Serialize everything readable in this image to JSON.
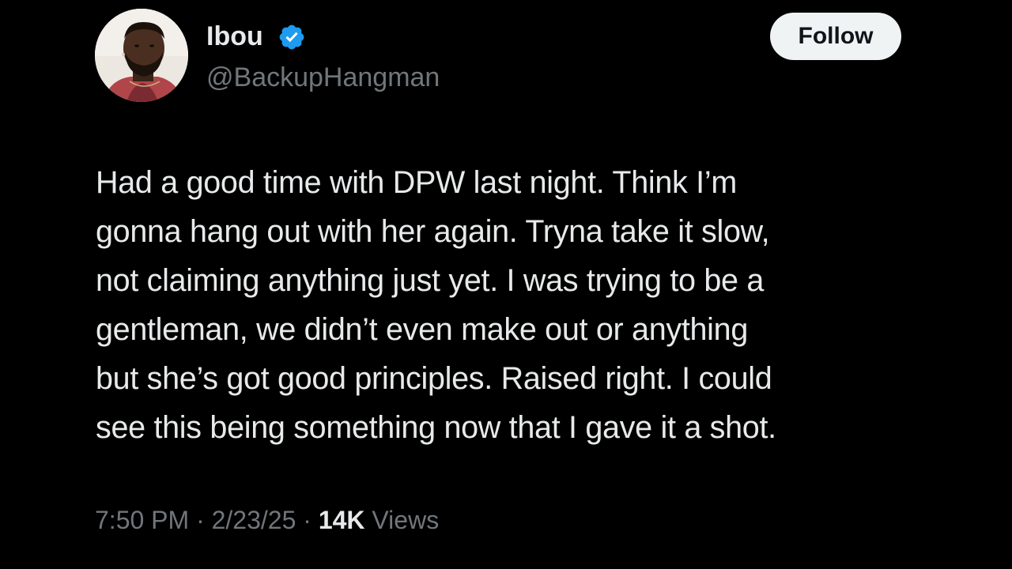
{
  "author": {
    "display_name": "Ibou",
    "handle": "@BackupHangman",
    "verified_icon": "verified-badge-icon",
    "avatar_icon": "profile-avatar"
  },
  "follow_button": {
    "label": "Follow"
  },
  "tweet": {
    "lines": [
      "Had a good time with DPW last night. Think I’m",
      "gonna hang out with her again. Tryna take it slow,",
      "not claiming anything just yet. I was trying to be a",
      "gentleman, we didn’t even make out or anything",
      "but she’s got good principles. Raised right. I could",
      "see this being something now that I gave it a shot."
    ]
  },
  "meta": {
    "time": "7:50 PM",
    "separator": " · ",
    "date": "2/23/25",
    "views_count": "14K",
    "views_label": " Views"
  },
  "colors": {
    "background": "#000000",
    "primary_text": "#e7e9ea",
    "secondary_text": "#71767b",
    "verified_blue": "#1d9bf0",
    "follow_bg": "#eff3f4",
    "follow_text": "#0f1419"
  }
}
